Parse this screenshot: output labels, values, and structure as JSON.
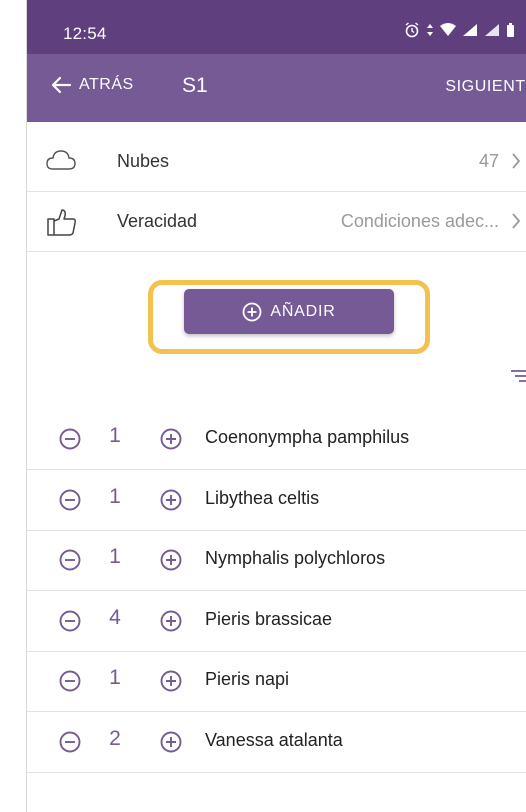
{
  "status": {
    "time": "12:54"
  },
  "appbar": {
    "back_label": "ATRÁS",
    "title": "S1",
    "next_label": "SIGUIENTE"
  },
  "info": {
    "clouds": {
      "label": "Nubes",
      "value": "47"
    },
    "veracity": {
      "label": "Veracidad",
      "value": "Condiciones adec..."
    }
  },
  "add_button": {
    "label": "AÑADIR"
  },
  "species": [
    {
      "count": "1",
      "name": "Coenonympha pamphilus"
    },
    {
      "count": "1",
      "name": "Libythea celtis"
    },
    {
      "count": "1",
      "name": "Nymphalis polychloros"
    },
    {
      "count": "4",
      "name": "Pieris brassicae"
    },
    {
      "count": "1",
      "name": "Pieris napi"
    },
    {
      "count": "2",
      "name": "Vanessa atalanta"
    }
  ],
  "colors": {
    "statusbar": "#5f3f7d",
    "appbar": "#765a96",
    "accent": "#765a96",
    "highlight": "#f3c14e"
  }
}
